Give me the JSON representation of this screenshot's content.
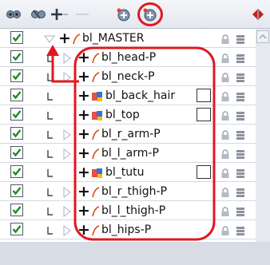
{
  "toolbar": {
    "buttons": [
      {
        "name": "toggle-visibility-icon"
      },
      {
        "name": "toggle-visibility-off-icon"
      },
      {
        "name": "add-peg-icon"
      },
      {
        "name": "add-drawing-icon"
      },
      {
        "name": "add-layer-icon"
      },
      {
        "name": "collapse-expand-icon"
      }
    ]
  },
  "layers": [
    {
      "name": "bl_MASTER",
      "level": 0,
      "expanded": true,
      "type": "peg",
      "swatch": false,
      "checked": true
    },
    {
      "name": "bl_head-P",
      "level": 1,
      "expanded": false,
      "type": "peg",
      "swatch": false,
      "checked": true
    },
    {
      "name": "bl_neck-P",
      "level": 1,
      "expanded": false,
      "type": "peg",
      "swatch": false,
      "checked": true
    },
    {
      "name": "bl_back_hair",
      "level": 1,
      "expanded": false,
      "type": "drawing",
      "swatch": true,
      "checked": true
    },
    {
      "name": "bl_top",
      "level": 1,
      "expanded": false,
      "type": "drawing",
      "swatch": true,
      "checked": true
    },
    {
      "name": "bl_r_arm-P",
      "level": 1,
      "expanded": false,
      "type": "peg",
      "swatch": false,
      "checked": true
    },
    {
      "name": "bl_l_arm-P",
      "level": 1,
      "expanded": false,
      "type": "peg",
      "swatch": false,
      "checked": true
    },
    {
      "name": "bl_tutu",
      "level": 1,
      "expanded": false,
      "type": "drawing",
      "swatch": true,
      "checked": true
    },
    {
      "name": "bl_r_thigh-P",
      "level": 1,
      "expanded": false,
      "type": "peg",
      "swatch": false,
      "checked": true
    },
    {
      "name": "bl_l_thigh-P",
      "level": 1,
      "expanded": false,
      "type": "peg",
      "swatch": false,
      "checked": true
    },
    {
      "name": "bl_hips-P",
      "level": 1,
      "expanded": false,
      "type": "peg",
      "swatch": false,
      "checked": true
    }
  ],
  "colors": {
    "annotation": "#e01820",
    "checkmark": "#1f8a1f",
    "peg_icon": "#d84a1a"
  }
}
